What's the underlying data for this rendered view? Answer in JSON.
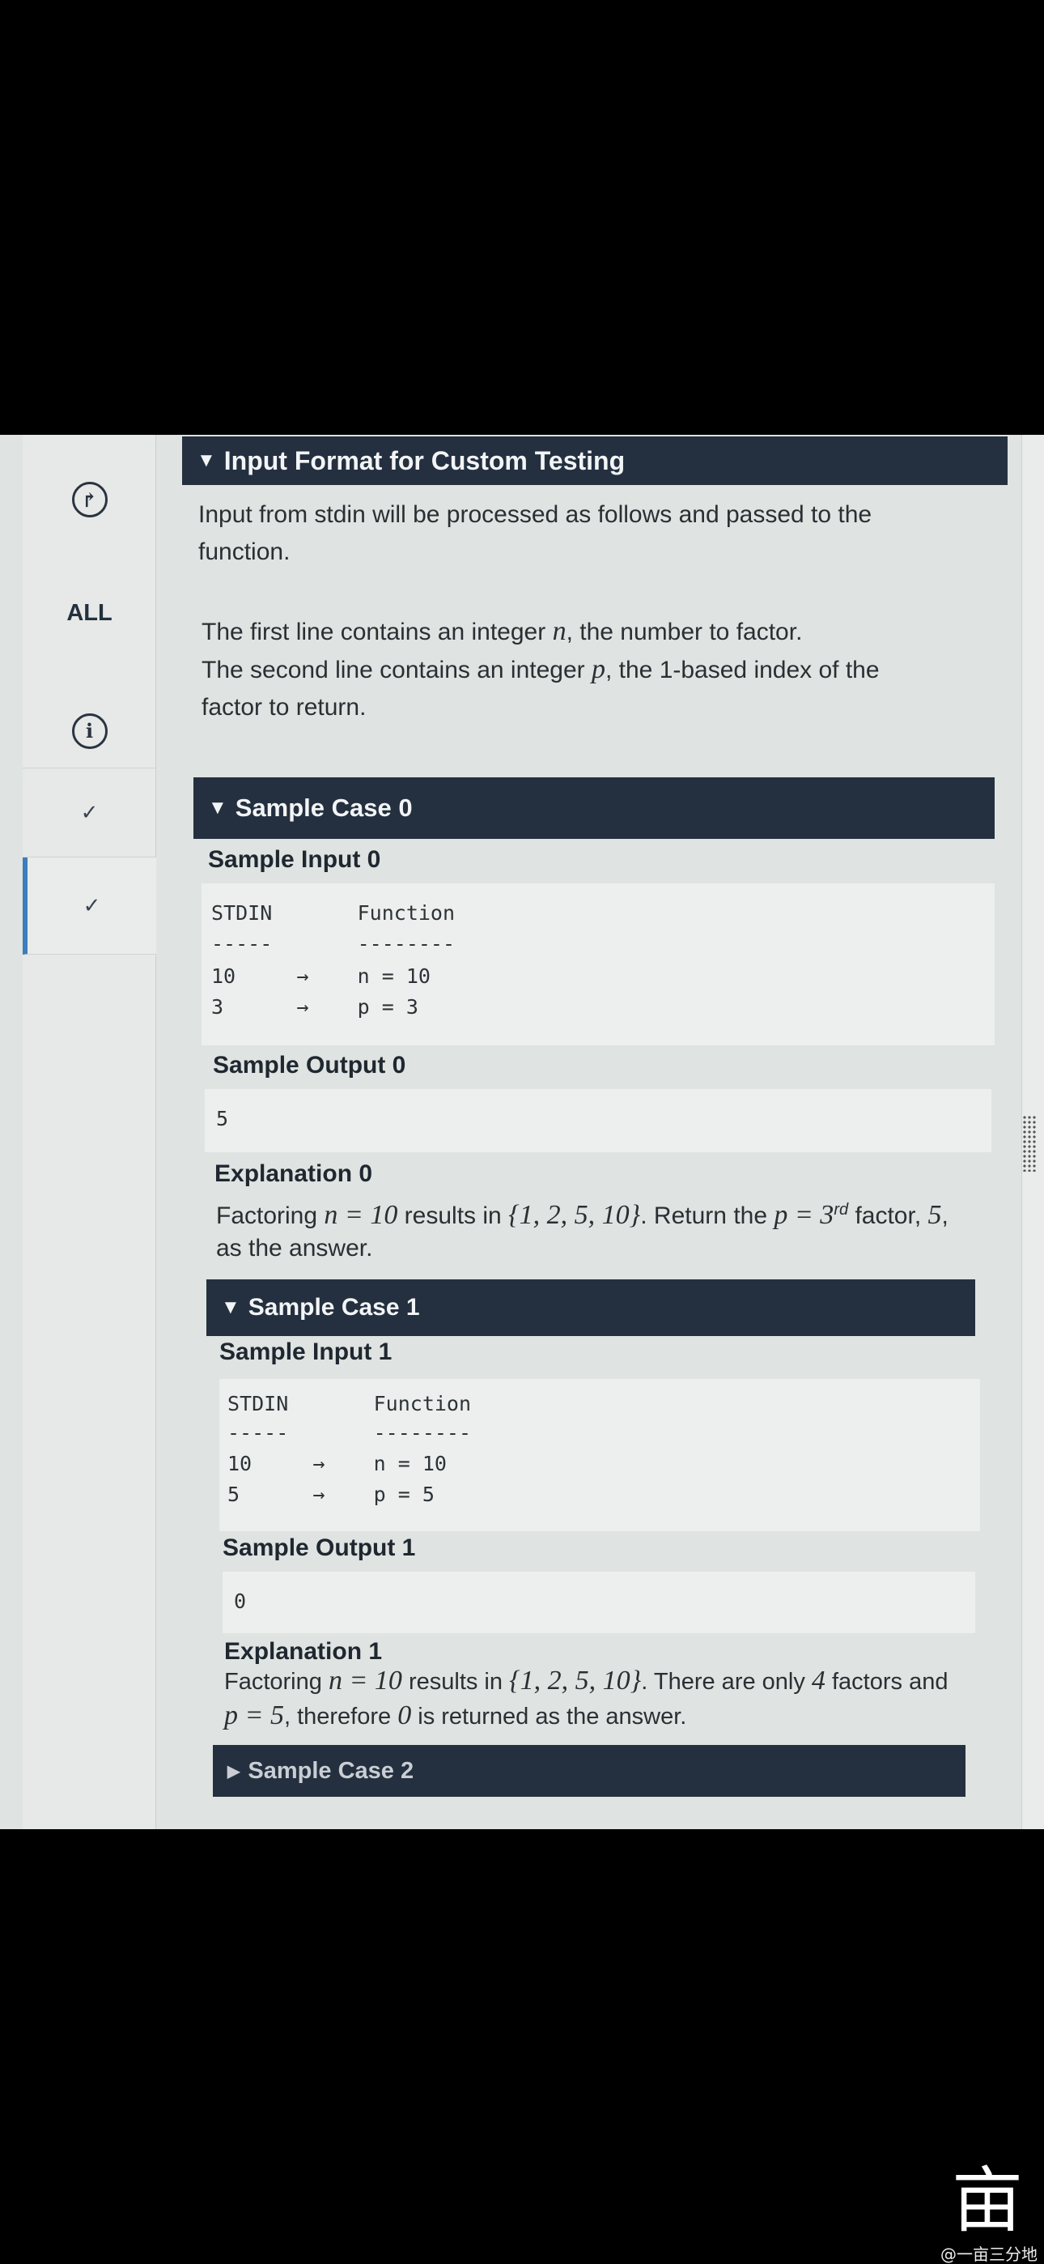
{
  "rail": {
    "all_label": "ALL",
    "icons": [
      "brand-logo-icon",
      "info-icon",
      "check-icon",
      "check-icon"
    ]
  },
  "input_format": {
    "header": "Input Format for Custom Testing",
    "intro_line1": "Input from stdin will be processed as follows and passed to the",
    "intro_line2": "function.",
    "line1_pre": "The first line contains an integer ",
    "line1_var": "n",
    "line1_post": ", the number to factor.",
    "line2_pre": "The second line contains an integer ",
    "line2_var": "p",
    "line2_post": ", the 1-based index of the",
    "line3": "factor to return."
  },
  "case0": {
    "header": "Sample Case 0",
    "input_title": "Sample Input 0",
    "input_lines": [
      "STDIN       Function",
      "-----       --------",
      "10     →    n = 10",
      "3      →    p = 3"
    ],
    "output_title": "Sample Output 0",
    "output": "5",
    "explanation_title": "Explanation 0",
    "exp_a": "Factoring ",
    "exp_b": "n = 10",
    "exp_c": " results in ",
    "exp_d": "{1, 2, 5, 10}",
    "exp_e": ". Return the ",
    "exp_f": "p = 3",
    "exp_sup": "rd",
    "exp_g": " factor, ",
    "exp_h": "5",
    "exp_i": ",",
    "exp_line2": "as the answer."
  },
  "case1": {
    "header": "Sample Case 1",
    "input_title": "Sample Input 1",
    "input_lines": [
      "STDIN       Function",
      "-----       --------",
      "10     →    n = 10",
      "5      →    p = 5"
    ],
    "output_title": "Sample Output 1",
    "output": "0",
    "explanation_title": "Explanation 1",
    "exp_a": "Factoring ",
    "exp_b": "n = 10",
    "exp_c": " results in ",
    "exp_d": "{1, 2, 5, 10}",
    "exp_e": ". There are only ",
    "exp_f": "4",
    "exp_g": " factors and",
    "exp_h": "p = 5",
    "exp_i": ", therefore ",
    "exp_j": "0",
    "exp_k": " is returned as the answer."
  },
  "case2": {
    "header": "Sample Case 2"
  },
  "watermark": {
    "mark": "亩",
    "text": "@一亩三分地"
  }
}
